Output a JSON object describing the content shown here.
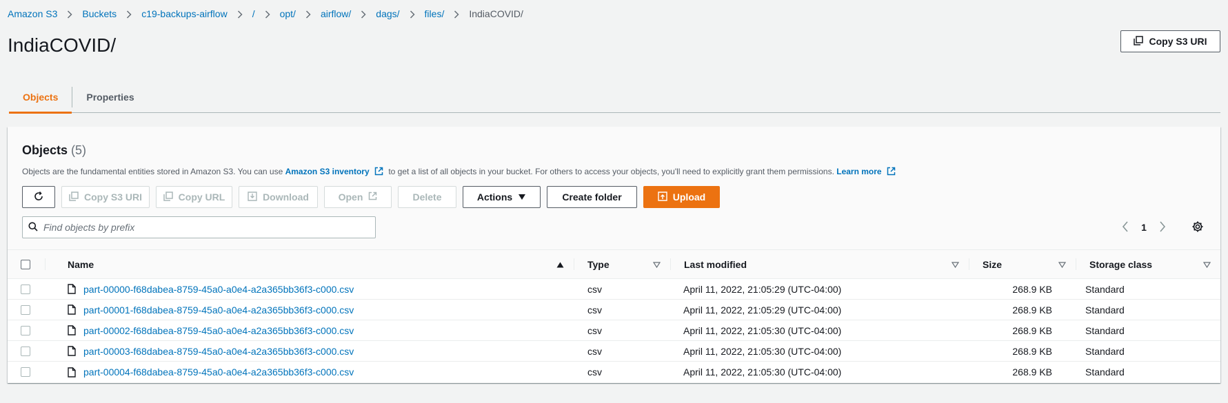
{
  "breadcrumb": [
    {
      "label": "Amazon S3"
    },
    {
      "label": "Buckets"
    },
    {
      "label": "c19-backups-airflow"
    },
    {
      "label": "/"
    },
    {
      "label": "opt/"
    },
    {
      "label": "airflow/"
    },
    {
      "label": "dags/"
    },
    {
      "label": "files/"
    },
    {
      "label": "IndiaCOVID/"
    }
  ],
  "header": {
    "title": "IndiaCOVID/",
    "copy_uri_label": "Copy S3 URI"
  },
  "tabs": [
    {
      "label": "Objects",
      "active": true
    },
    {
      "label": "Properties",
      "active": false
    }
  ],
  "objects_panel": {
    "title": "Objects",
    "count": "(5)",
    "desc_before": "Objects are the fundamental entities stored in Amazon S3. You can use",
    "desc_link": "Amazon S3 inventory",
    "desc_after": "to get a list of all objects in your bucket. For others to access your objects, you'll need to explicitly grant them permissions.",
    "learn_more": "Learn more"
  },
  "toolbar": {
    "copy_s3_uri": "Copy S3 URI",
    "copy_url": "Copy URL",
    "download": "Download",
    "open": "Open",
    "delete": "Delete",
    "actions": "Actions",
    "create_folder": "Create folder",
    "upload": "Upload"
  },
  "search": {
    "placeholder": "Find objects by prefix",
    "value": ""
  },
  "pagination": {
    "current_page": "1"
  },
  "table": {
    "columns": {
      "name": "Name",
      "type": "Type",
      "last_modified": "Last modified",
      "size": "Size",
      "storage_class": "Storage class"
    },
    "rows": [
      {
        "name": "part-00000-f68dabea-8759-45a0-a0e4-a2a365bb36f3-c000.csv",
        "type": "csv",
        "last_modified": "April 11, 2022, 21:05:29 (UTC-04:00)",
        "size": "268.9 KB",
        "storage_class": "Standard"
      },
      {
        "name": "part-00001-f68dabea-8759-45a0-a0e4-a2a365bb36f3-c000.csv",
        "type": "csv",
        "last_modified": "April 11, 2022, 21:05:29 (UTC-04:00)",
        "size": "268.9 KB",
        "storage_class": "Standard"
      },
      {
        "name": "part-00002-f68dabea-8759-45a0-a0e4-a2a365bb36f3-c000.csv",
        "type": "csv",
        "last_modified": "April 11, 2022, 21:05:30 (UTC-04:00)",
        "size": "268.9 KB",
        "storage_class": "Standard"
      },
      {
        "name": "part-00003-f68dabea-8759-45a0-a0e4-a2a365bb36f3-c000.csv",
        "type": "csv",
        "last_modified": "April 11, 2022, 21:05:30 (UTC-04:00)",
        "size": "268.9 KB",
        "storage_class": "Standard"
      },
      {
        "name": "part-00004-f68dabea-8759-45a0-a0e4-a2a365bb36f3-c000.csv",
        "type": "csv",
        "last_modified": "April 11, 2022, 21:05:30 (UTC-04:00)",
        "size": "268.9 KB",
        "storage_class": "Standard"
      }
    ]
  },
  "colors": {
    "accent": "#ec7211",
    "link": "#0073bb",
    "background": "#f2f3f3"
  }
}
